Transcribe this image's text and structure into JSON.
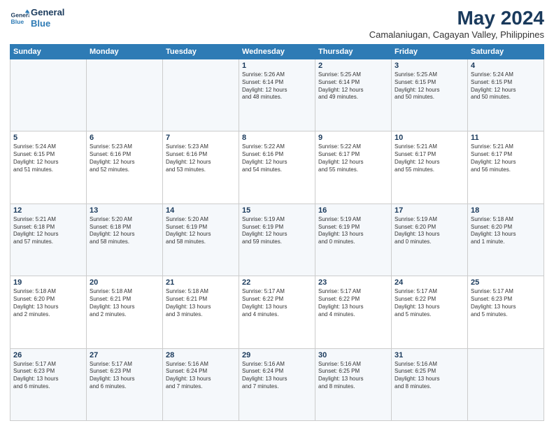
{
  "logo": {
    "line1": "General",
    "line2": "Blue"
  },
  "header": {
    "month": "May 2024",
    "location": "Camalaniugan, Cagayan Valley, Philippines"
  },
  "weekdays": [
    "Sunday",
    "Monday",
    "Tuesday",
    "Wednesday",
    "Thursday",
    "Friday",
    "Saturday"
  ],
  "weeks": [
    [
      {
        "day": "",
        "info": ""
      },
      {
        "day": "",
        "info": ""
      },
      {
        "day": "",
        "info": ""
      },
      {
        "day": "1",
        "info": "Sunrise: 5:26 AM\nSunset: 6:14 PM\nDaylight: 12 hours\nand 48 minutes."
      },
      {
        "day": "2",
        "info": "Sunrise: 5:25 AM\nSunset: 6:14 PM\nDaylight: 12 hours\nand 49 minutes."
      },
      {
        "day": "3",
        "info": "Sunrise: 5:25 AM\nSunset: 6:15 PM\nDaylight: 12 hours\nand 50 minutes."
      },
      {
        "day": "4",
        "info": "Sunrise: 5:24 AM\nSunset: 6:15 PM\nDaylight: 12 hours\nand 50 minutes."
      }
    ],
    [
      {
        "day": "5",
        "info": "Sunrise: 5:24 AM\nSunset: 6:15 PM\nDaylight: 12 hours\nand 51 minutes."
      },
      {
        "day": "6",
        "info": "Sunrise: 5:23 AM\nSunset: 6:16 PM\nDaylight: 12 hours\nand 52 minutes."
      },
      {
        "day": "7",
        "info": "Sunrise: 5:23 AM\nSunset: 6:16 PM\nDaylight: 12 hours\nand 53 minutes."
      },
      {
        "day": "8",
        "info": "Sunrise: 5:22 AM\nSunset: 6:16 PM\nDaylight: 12 hours\nand 54 minutes."
      },
      {
        "day": "9",
        "info": "Sunrise: 5:22 AM\nSunset: 6:17 PM\nDaylight: 12 hours\nand 55 minutes."
      },
      {
        "day": "10",
        "info": "Sunrise: 5:21 AM\nSunset: 6:17 PM\nDaylight: 12 hours\nand 55 minutes."
      },
      {
        "day": "11",
        "info": "Sunrise: 5:21 AM\nSunset: 6:17 PM\nDaylight: 12 hours\nand 56 minutes."
      }
    ],
    [
      {
        "day": "12",
        "info": "Sunrise: 5:21 AM\nSunset: 6:18 PM\nDaylight: 12 hours\nand 57 minutes."
      },
      {
        "day": "13",
        "info": "Sunrise: 5:20 AM\nSunset: 6:18 PM\nDaylight: 12 hours\nand 58 minutes."
      },
      {
        "day": "14",
        "info": "Sunrise: 5:20 AM\nSunset: 6:19 PM\nDaylight: 12 hours\nand 58 minutes."
      },
      {
        "day": "15",
        "info": "Sunrise: 5:19 AM\nSunset: 6:19 PM\nDaylight: 12 hours\nand 59 minutes."
      },
      {
        "day": "16",
        "info": "Sunrise: 5:19 AM\nSunset: 6:19 PM\nDaylight: 13 hours\nand 0 minutes."
      },
      {
        "day": "17",
        "info": "Sunrise: 5:19 AM\nSunset: 6:20 PM\nDaylight: 13 hours\nand 0 minutes."
      },
      {
        "day": "18",
        "info": "Sunrise: 5:18 AM\nSunset: 6:20 PM\nDaylight: 13 hours\nand 1 minute."
      }
    ],
    [
      {
        "day": "19",
        "info": "Sunrise: 5:18 AM\nSunset: 6:20 PM\nDaylight: 13 hours\nand 2 minutes."
      },
      {
        "day": "20",
        "info": "Sunrise: 5:18 AM\nSunset: 6:21 PM\nDaylight: 13 hours\nand 2 minutes."
      },
      {
        "day": "21",
        "info": "Sunrise: 5:18 AM\nSunset: 6:21 PM\nDaylight: 13 hours\nand 3 minutes."
      },
      {
        "day": "22",
        "info": "Sunrise: 5:17 AM\nSunset: 6:22 PM\nDaylight: 13 hours\nand 4 minutes."
      },
      {
        "day": "23",
        "info": "Sunrise: 5:17 AM\nSunset: 6:22 PM\nDaylight: 13 hours\nand 4 minutes."
      },
      {
        "day": "24",
        "info": "Sunrise: 5:17 AM\nSunset: 6:22 PM\nDaylight: 13 hours\nand 5 minutes."
      },
      {
        "day": "25",
        "info": "Sunrise: 5:17 AM\nSunset: 6:23 PM\nDaylight: 13 hours\nand 5 minutes."
      }
    ],
    [
      {
        "day": "26",
        "info": "Sunrise: 5:17 AM\nSunset: 6:23 PM\nDaylight: 13 hours\nand 6 minutes."
      },
      {
        "day": "27",
        "info": "Sunrise: 5:17 AM\nSunset: 6:23 PM\nDaylight: 13 hours\nand 6 minutes."
      },
      {
        "day": "28",
        "info": "Sunrise: 5:16 AM\nSunset: 6:24 PM\nDaylight: 13 hours\nand 7 minutes."
      },
      {
        "day": "29",
        "info": "Sunrise: 5:16 AM\nSunset: 6:24 PM\nDaylight: 13 hours\nand 7 minutes."
      },
      {
        "day": "30",
        "info": "Sunrise: 5:16 AM\nSunset: 6:25 PM\nDaylight: 13 hours\nand 8 minutes."
      },
      {
        "day": "31",
        "info": "Sunrise: 5:16 AM\nSunset: 6:25 PM\nDaylight: 13 hours\nand 8 minutes."
      },
      {
        "day": "",
        "info": ""
      }
    ]
  ]
}
